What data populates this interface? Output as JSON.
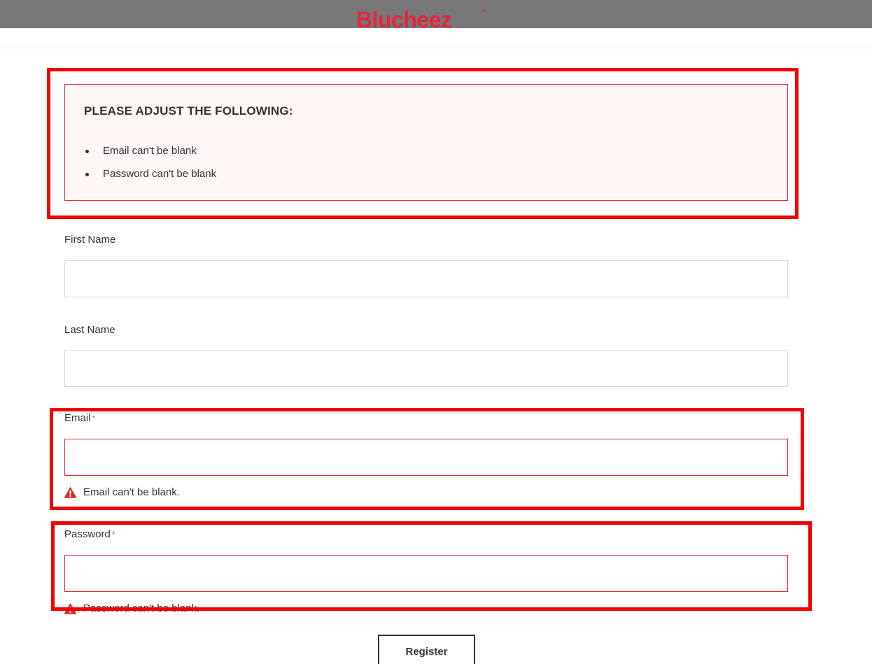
{
  "header": {
    "logo_text": "Blucheez",
    "logo_tm": "™",
    "brand_color": "#e3263f"
  },
  "error_summary": {
    "title": "PLEASE ADJUST THE FOLLOWING:",
    "items": [
      "Email can't be blank",
      "Password can't be blank"
    ]
  },
  "form": {
    "first_name": {
      "label": "First Name",
      "value": ""
    },
    "last_name": {
      "label": "Last Name",
      "value": ""
    },
    "email": {
      "label": "Email",
      "required_mark": "*",
      "value": "",
      "error": "Email can't be blank."
    },
    "password": {
      "label": "Password",
      "required_mark": "*",
      "value": "",
      "error": "Password can't be blank."
    },
    "submit_label": "Register"
  },
  "colors": {
    "error_border": "#e0262d",
    "highlight": "#f40000",
    "error_bg": "#fff6f6",
    "warning_icon": "#e0262d"
  },
  "icons": {
    "field_error": "warning-triangle-icon"
  }
}
